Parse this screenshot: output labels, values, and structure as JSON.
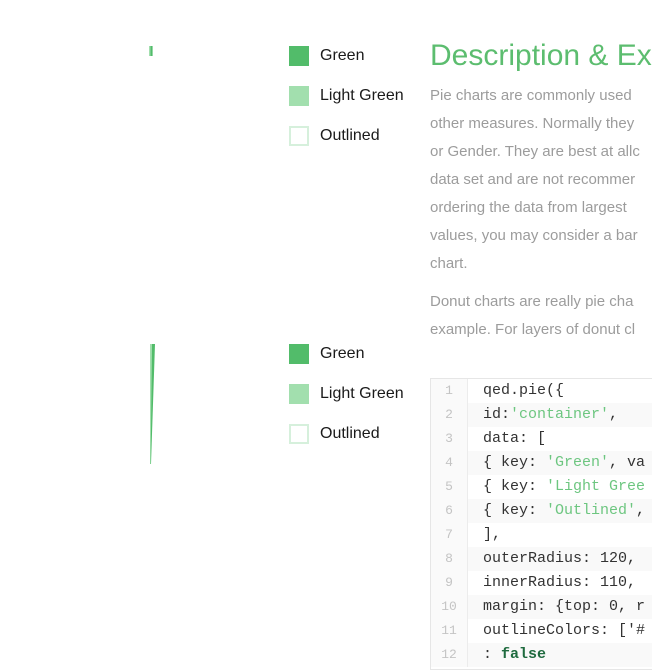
{
  "charts": [
    {
      "legend": [
        {
          "label": "Green",
          "color": "#52bc6a",
          "outlined": false
        },
        {
          "label": "Light Green",
          "color": "#a2dfae",
          "outlined": false
        },
        {
          "label": "Outlined",
          "color": "#ffffff",
          "border": "#d6f0dc",
          "outlined": true
        }
      ]
    },
    {
      "legend": [
        {
          "label": "Green",
          "color": "#52bc6a",
          "outlined": false
        },
        {
          "label": "Light Green",
          "color": "#a2dfae",
          "outlined": false
        },
        {
          "label": "Outlined",
          "color": "#ffffff",
          "border": "#d6f0dc",
          "outlined": true
        }
      ]
    }
  ],
  "chart_data": [
    {
      "type": "pie",
      "categories": [
        "Green",
        "Light Green",
        "Outlined"
      ],
      "colors": [
        "#52bc6a",
        "#a2dfae",
        "#ffffff"
      ]
    },
    {
      "type": "pie",
      "categories": [
        "Green",
        "Light Green",
        "Outlined"
      ],
      "colors": [
        "#52bc6a",
        "#a2dfae",
        "#ffffff"
      ]
    }
  ],
  "description": {
    "title": "Description & Exa",
    "para1": [
      "Pie charts are commonly used",
      "other measures. Normally they",
      "or Gender. They are best at allc",
      "data set and are not recommer",
      "ordering the data from largest",
      "values, you may consider a bar",
      "chart."
    ],
    "para2": [
      "Donut charts are really pie cha",
      "example. For layers of donut cl"
    ]
  },
  "code": {
    "lines": [
      {
        "n": "1",
        "parts": [
          [
            "t",
            "qed.pie({"
          ]
        ]
      },
      {
        "n": "2",
        "parts": [
          [
            "t",
            "id:"
          ],
          [
            "s",
            "'container'"
          ],
          [
            "t",
            ","
          ]
        ]
      },
      {
        "n": "3",
        "parts": [
          [
            "t",
            "data: ["
          ]
        ]
      },
      {
        "n": "4",
        "parts": [
          [
            "t",
            "{ key: "
          ],
          [
            "s",
            "'Green'"
          ],
          [
            "t",
            ", va"
          ]
        ]
      },
      {
        "n": "5",
        "parts": [
          [
            "t",
            "{ key: "
          ],
          [
            "s",
            "'Light Gree"
          ]
        ]
      },
      {
        "n": "6",
        "parts": [
          [
            "t",
            "{ key: "
          ],
          [
            "s",
            "'Outlined'"
          ],
          [
            "t",
            ","
          ]
        ]
      },
      {
        "n": "7",
        "parts": [
          [
            "t",
            "],"
          ]
        ]
      },
      {
        "n": "8",
        "parts": [
          [
            "t",
            "outerRadius: 120,"
          ]
        ]
      },
      {
        "n": "9",
        "parts": [
          [
            "t",
            "innerRadius: 110,"
          ]
        ]
      },
      {
        "n": "10",
        "parts": [
          [
            "t",
            "margin: {top: 0, r"
          ]
        ]
      },
      {
        "n": "11",
        "parts": [
          [
            "t",
            "outlineColors: ['#"
          ]
        ]
      },
      {
        "n": "12",
        "parts": [
          [
            "t",
            "  : "
          ],
          [
            "k",
            "false"
          ]
        ]
      }
    ]
  }
}
